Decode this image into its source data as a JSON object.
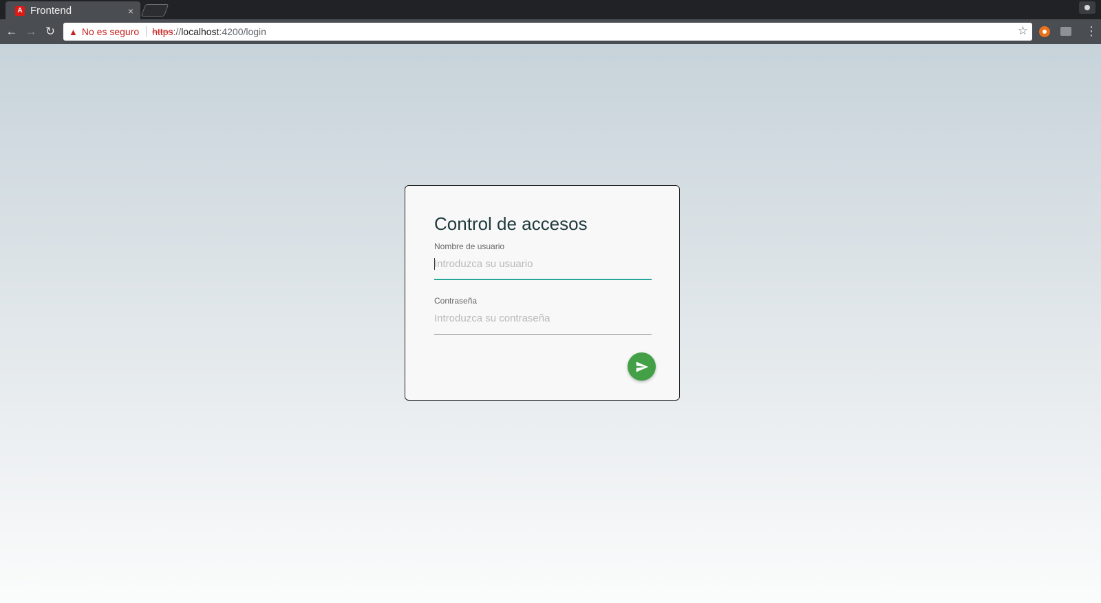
{
  "browser": {
    "tab": {
      "title": "Frontend",
      "favicon": "A",
      "close": "×"
    },
    "nav": {
      "back": "←",
      "forward": "→",
      "reload": "↻"
    },
    "address": {
      "security_label": "No es seguro",
      "scheme": "https",
      "separator": "://",
      "host": "localhost",
      "rest": ":4200/login"
    },
    "icons": {
      "star": "☆",
      "menu": "⋮",
      "warning": "▲"
    }
  },
  "login": {
    "title": "Control de accesos",
    "username": {
      "label": "Nombre de usuario",
      "placeholder": "Introduzca su usuario",
      "value": ""
    },
    "password": {
      "label": "Contraseña",
      "placeholder": "Introduzca su contraseña",
      "value": ""
    },
    "submit_icon": "send-icon"
  },
  "colors": {
    "accent": "#26a69a",
    "submit": "#43a047",
    "warning": "#c5221f",
    "title": "#1f3a3d"
  }
}
